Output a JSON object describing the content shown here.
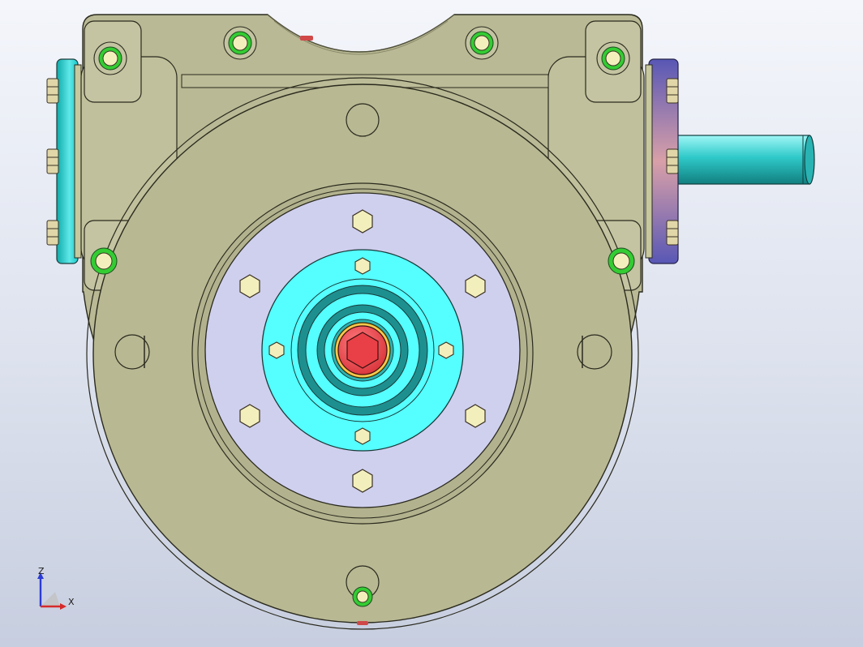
{
  "view": {
    "background_top": "#f4f6fb",
    "background_bottom": "#c7cedf"
  },
  "colors": {
    "housing": "#b9b995",
    "housing_light": "#c4c4a2",
    "outline": "#2a2a1e",
    "flange_plate": "#cfcfee",
    "hub": "#55ffff",
    "hub_dark": "#1e8f8f",
    "bore_red": "#ee4b50",
    "bolt_fill": "#f3efbd",
    "bolt_ring": "#33cc33",
    "shaft": "#2fc9c9",
    "end_cap_left": "#18c9c9",
    "end_cap_right": "#6a69c4"
  },
  "model": {
    "part_name": "worm-gearbox-front-view"
  },
  "triad": {
    "z_label": "Z",
    "x_label": "X"
  }
}
